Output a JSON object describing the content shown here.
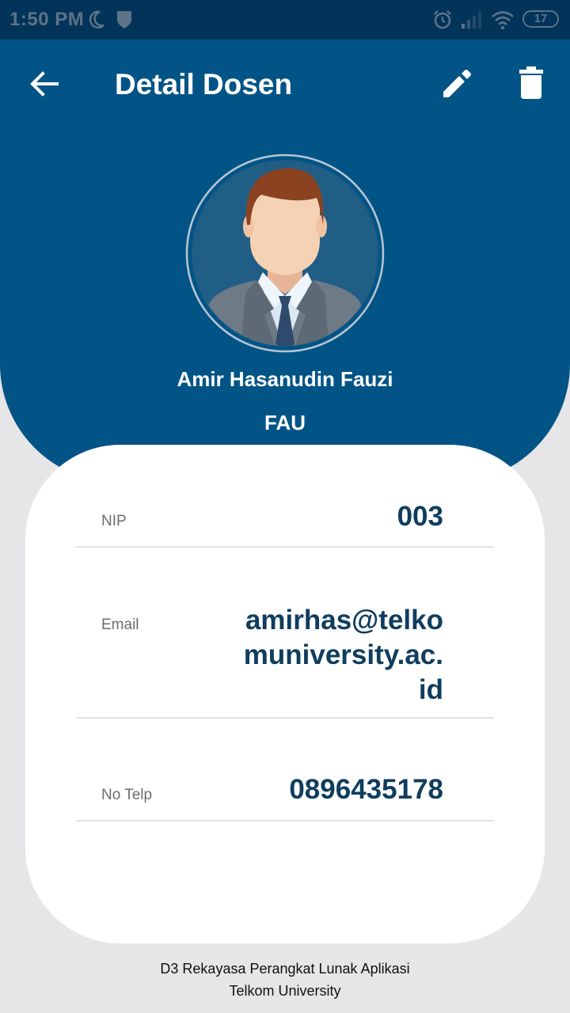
{
  "status_bar": {
    "time": "1:50 PM",
    "battery": "17"
  },
  "header": {
    "title": "Detail Dosen"
  },
  "profile": {
    "name": "Amir Hasanudin Fauzi",
    "code": "FAU"
  },
  "details": {
    "nip_label": "NIP",
    "nip_value": "003",
    "email_label": "Email",
    "email_value": "amirhas@telkomuniversity.ac.id",
    "phone_label": "No Telp",
    "phone_value": "0896435178"
  },
  "footer": {
    "line1": "D3 Rekayasa Perangkat Lunak Aplikasi",
    "line2": "Telkom University"
  },
  "colors": {
    "primary": "#035486",
    "status_bar": "#02345a",
    "value_text": "#0f3d5e",
    "background": "#e6e6e8"
  },
  "icons": {
    "back": "arrow-left-icon",
    "edit": "pencil-icon",
    "delete": "trash-icon"
  }
}
